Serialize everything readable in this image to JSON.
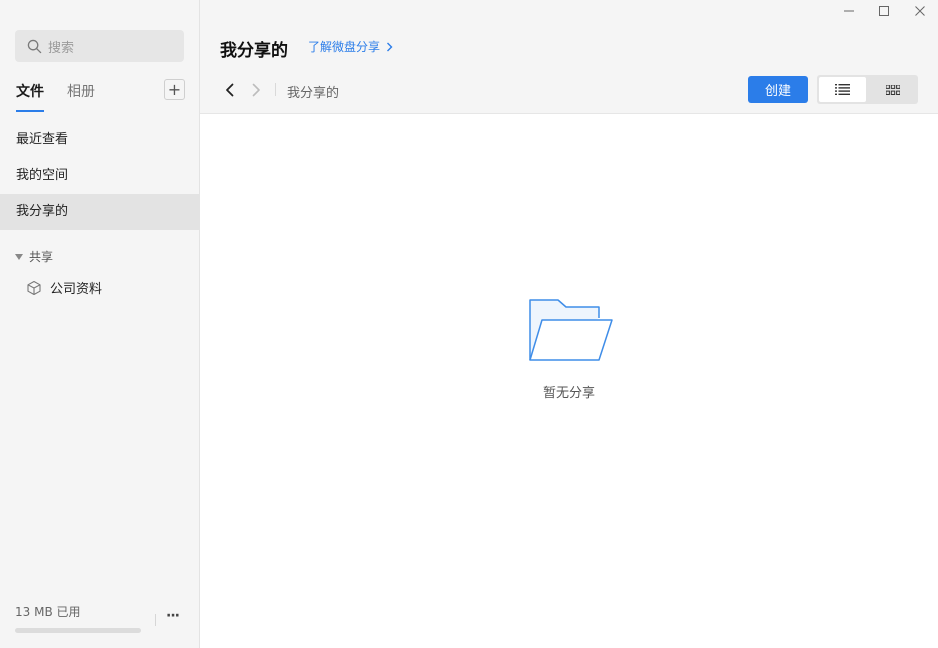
{
  "sidebar": {
    "search_placeholder": "搜索",
    "tabs": [
      {
        "label": "文件",
        "active": true
      },
      {
        "label": "相册",
        "active": false
      }
    ],
    "add_label": "+",
    "items": [
      {
        "label": "最近查看",
        "selected": false
      },
      {
        "label": "我的空间",
        "selected": false
      },
      {
        "label": "我分享的",
        "selected": true
      }
    ],
    "shared_section": {
      "label": "共享",
      "items": [
        {
          "label": "公司资料",
          "icon": "cube-icon"
        }
      ]
    },
    "storage": {
      "label": "13 MB 已用",
      "used_fraction": 0
    },
    "more_label": "···"
  },
  "header": {
    "title": "我分享的",
    "learn_link": "了解微盘分享",
    "breadcrumb": "我分享的",
    "create_label": "创建",
    "view_mode": "list"
  },
  "main": {
    "empty_text": "暂无分享",
    "empty_icon": "folder-open-icon"
  },
  "colors": {
    "accent": "#2b7de9",
    "sidebar_bg": "#f5f5f5",
    "selected_bg": "#e3e3e3"
  }
}
